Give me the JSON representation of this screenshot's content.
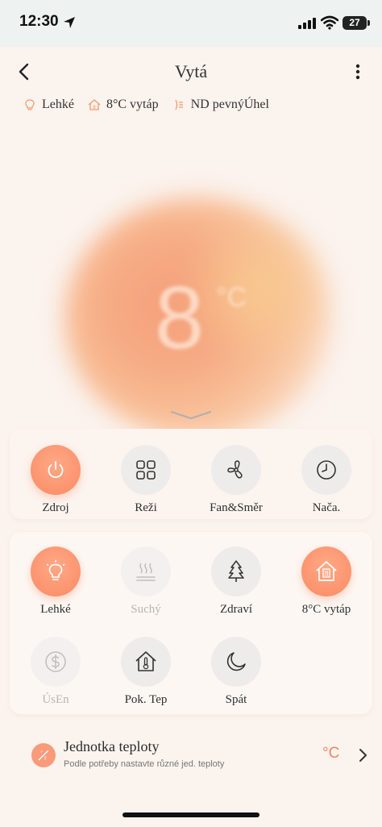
{
  "status_bar": {
    "time": "12:30",
    "battery": "27"
  },
  "header": {
    "title": "Vytá"
  },
  "chips": [
    {
      "icon": "bulb-icon",
      "label": "Lehké"
    },
    {
      "icon": "home-heat-icon",
      "label": "8°C vytáp"
    },
    {
      "icon": "swing-icon",
      "label": "ND pevnýÚhel"
    }
  ],
  "hero": {
    "temperature": "8",
    "unit": "°C"
  },
  "controls": [
    {
      "icon": "power-icon",
      "label": "Zdroj",
      "state": "active"
    },
    {
      "icon": "grid-icon",
      "label": "Reži",
      "state": "normal"
    },
    {
      "icon": "fan-icon",
      "label": "Fan&Směr",
      "state": "normal"
    },
    {
      "icon": "clock-icon",
      "label": "Nača.",
      "state": "normal"
    }
  ],
  "functions": [
    {
      "icon": "bulb-icon",
      "label": "Lehké",
      "state": "active"
    },
    {
      "icon": "dry-icon",
      "label": "Suchý",
      "state": "disabled"
    },
    {
      "icon": "tree-icon",
      "label": "Zdraví",
      "state": "normal"
    },
    {
      "icon": "home-8-icon",
      "label": "8°C vytáp",
      "state": "active"
    },
    {
      "icon": "dollar-icon",
      "label": "ÚsEn",
      "state": "disabled"
    },
    {
      "icon": "thermometer-home-icon",
      "label": "Pok. Tep",
      "state": "normal"
    },
    {
      "icon": "moon-icon",
      "label": "Spát",
      "state": "normal"
    }
  ],
  "unit_setting": {
    "title": "Jednotka teploty",
    "subtitle": "Podle potřeby nastavte různé jed. teploty",
    "value": "°C"
  },
  "colors": {
    "accent": "#fa8a63",
    "background": "#fbf3ee"
  }
}
